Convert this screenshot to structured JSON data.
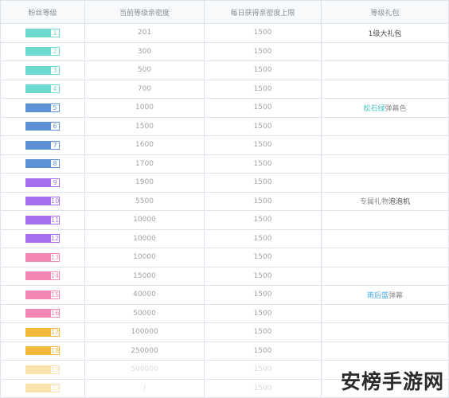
{
  "headers": [
    "粉丝等级",
    "当前等级亲密度",
    "每日获得亲密度上限",
    "等级礼包"
  ],
  "rows": [
    {
      "level": "1",
      "color": "#6dd9cf",
      "intimacy": "201",
      "limit": "1500"
    },
    {
      "level": "2",
      "color": "#6dd9cf",
      "intimacy": "300",
      "limit": "1500"
    },
    {
      "level": "3",
      "color": "#6dd9cf",
      "intimacy": "500",
      "limit": "1500"
    },
    {
      "level": "4",
      "color": "#6dd9cf",
      "intimacy": "700",
      "limit": "1500"
    },
    {
      "level": "5",
      "color": "#5c91d6",
      "intimacy": "1000",
      "limit": "1500"
    },
    {
      "level": "6",
      "color": "#5c91d6",
      "intimacy": "1500",
      "limit": "1500"
    },
    {
      "level": "7",
      "color": "#5c91d6",
      "intimacy": "1600",
      "limit": "1500"
    },
    {
      "level": "8",
      "color": "#5c91d6",
      "intimacy": "1700",
      "limit": "1500"
    },
    {
      "level": "9",
      "color": "#a56ef0",
      "intimacy": "1900",
      "limit": "1500"
    },
    {
      "level": "10",
      "color": "#a56ef0",
      "intimacy": "5500",
      "limit": "1500"
    },
    {
      "level": "11",
      "color": "#a56ef0",
      "intimacy": "10000",
      "limit": "1500"
    },
    {
      "level": "12",
      "color": "#a56ef0",
      "intimacy": "10000",
      "limit": "1500"
    },
    {
      "level": "13",
      "color": "#f585b2",
      "intimacy": "10000",
      "limit": "1500"
    },
    {
      "level": "14",
      "color": "#f585b2",
      "intimacy": "15000",
      "limit": "1500"
    },
    {
      "level": "15",
      "color": "#f585b2",
      "intimacy": "40000",
      "limit": "1500"
    },
    {
      "level": "16",
      "color": "#f585b2",
      "intimacy": "50000",
      "limit": "1500"
    },
    {
      "level": "17",
      "color": "#f3b93a",
      "intimacy": "100000",
      "limit": "1500"
    },
    {
      "level": "18",
      "color": "#f3b93a",
      "intimacy": "250000",
      "limit": "1500"
    },
    {
      "level": "19",
      "color": "#f3b93a",
      "intimacy": "500000",
      "limit": "1500",
      "faded": true
    },
    {
      "level": "20",
      "color": "#f3b93a",
      "intimacy": "/",
      "limit": "1500",
      "faded": true
    }
  ],
  "gifts": {
    "1": [
      {
        "text": "1级大礼包",
        "style": "dark"
      }
    ],
    "5": [
      {
        "text": "松石绿",
        "color": "#3fc7c0"
      },
      {
        "text": "弹幕色",
        "style": "plain"
      }
    ],
    "10": [
      {
        "text": "专属礼物",
        "style": "plain"
      },
      {
        "text": "泡泡机",
        "style": "dark"
      }
    ],
    "15": [
      {
        "text": "雨后蓝",
        "color": "#3ba3e0"
      },
      {
        "text": "弹幕",
        "style": "plain"
      }
    ]
  },
  "watermark": "安榜手游网"
}
